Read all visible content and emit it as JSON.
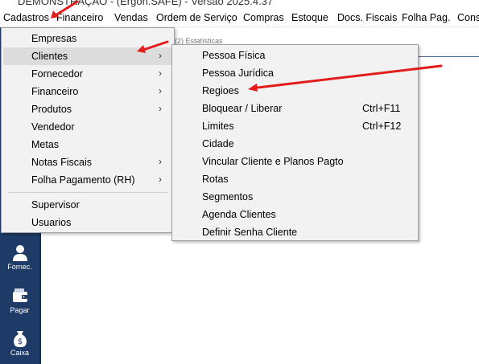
{
  "window": {
    "title": "DEMONSTRAÇÃO - (Ergon.SAFE) - Versão 2025.4.37"
  },
  "menubar": {
    "items": [
      "Cadastros",
      "Financeiro",
      "Vendas",
      "Ordem de Serviço",
      "Compras",
      "Estoque",
      "Docs. Fiscais",
      "Folha Pag.",
      "Cons"
    ]
  },
  "background_tab": {
    "label": "(2) Estatísticas"
  },
  "cadastros_menu": {
    "items": [
      {
        "label": "Empresas",
        "submenu": false
      },
      {
        "label": "Clientes",
        "submenu": true,
        "highlighted": true
      },
      {
        "label": "Fornecedor",
        "submenu": true
      },
      {
        "label": "Financeiro",
        "submenu": true
      },
      {
        "label": "Produtos",
        "submenu": true
      },
      {
        "label": "Vendedor",
        "submenu": false
      },
      {
        "label": "Metas",
        "submenu": false
      },
      {
        "label": "Notas Fiscais",
        "submenu": true
      },
      {
        "label": "Folha Pagamento (RH)",
        "submenu": true
      },
      {
        "label": "Supervisor",
        "submenu": false
      },
      {
        "label": "Usuarios",
        "submenu": false
      }
    ],
    "submenu_arrow": "›"
  },
  "clientes_submenu": {
    "items": [
      {
        "label": "Pessoa Física",
        "shortcut": ""
      },
      {
        "label": "Pessoa Jurídica",
        "shortcut": ""
      },
      {
        "label": "Regioes",
        "shortcut": ""
      },
      {
        "label": "Bloquear / Liberar",
        "shortcut": "Ctrl+F11"
      },
      {
        "label": "Limites",
        "shortcut": "Ctrl+F12"
      },
      {
        "label": "Cidade",
        "shortcut": ""
      },
      {
        "label": "Vincular Cliente e Planos Pagto",
        "shortcut": ""
      },
      {
        "label": "Rotas",
        "shortcut": ""
      },
      {
        "label": "Segmentos",
        "shortcut": ""
      },
      {
        "label": "Agenda Clientes",
        "shortcut": ""
      },
      {
        "label": "Definir Senha Cliente",
        "shortcut": ""
      }
    ]
  },
  "sidebar": {
    "buttons": [
      {
        "label": "Fornec.",
        "icon": "user-icon"
      },
      {
        "label": "Pagar",
        "icon": "wallet-icon"
      },
      {
        "label": "Caixa",
        "icon": "money-bag-icon"
      }
    ]
  },
  "colors": {
    "sidebar": "#1e3a66",
    "menu_bg": "#f2f2f2",
    "highlight": "#dcdcdc",
    "annotation_arrow": "#e21b1b"
  }
}
